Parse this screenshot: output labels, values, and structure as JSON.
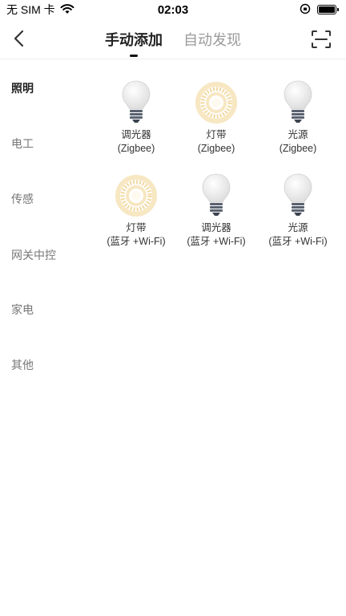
{
  "status": {
    "carrier": "无 SIM 卡",
    "time": "02:03"
  },
  "header": {
    "tabs": [
      {
        "label": "手动添加",
        "active": true
      },
      {
        "label": "自动发现",
        "active": false
      }
    ]
  },
  "sidebar": {
    "items": [
      {
        "label": "照明",
        "active": true
      },
      {
        "label": "电工",
        "active": false
      },
      {
        "label": "传感",
        "active": false
      },
      {
        "label": "网关中控",
        "active": false
      },
      {
        "label": "家电",
        "active": false
      },
      {
        "label": "其他",
        "active": false
      }
    ]
  },
  "devices": [
    {
      "name": "调光器",
      "protocol": "(Zigbee)",
      "icon": "bulb-icon"
    },
    {
      "name": "灯带",
      "protocol": "(Zigbee)",
      "icon": "light-strip-icon"
    },
    {
      "name": "光源",
      "protocol": "(Zigbee)",
      "icon": "bulb-icon"
    },
    {
      "name": "灯带",
      "protocol": "(蓝牙 +Wi-Fi)",
      "icon": "light-strip-icon"
    },
    {
      "name": "调光器",
      "protocol": "(蓝牙 +Wi-Fi)",
      "icon": "bulb-icon"
    },
    {
      "name": "光源",
      "protocol": "(蓝牙 +Wi-Fi)",
      "icon": "bulb-icon"
    }
  ],
  "colors": {
    "active_text": "#222222",
    "inactive_text": "#9a9a9a",
    "strip_glow": "#f3d9a1"
  }
}
